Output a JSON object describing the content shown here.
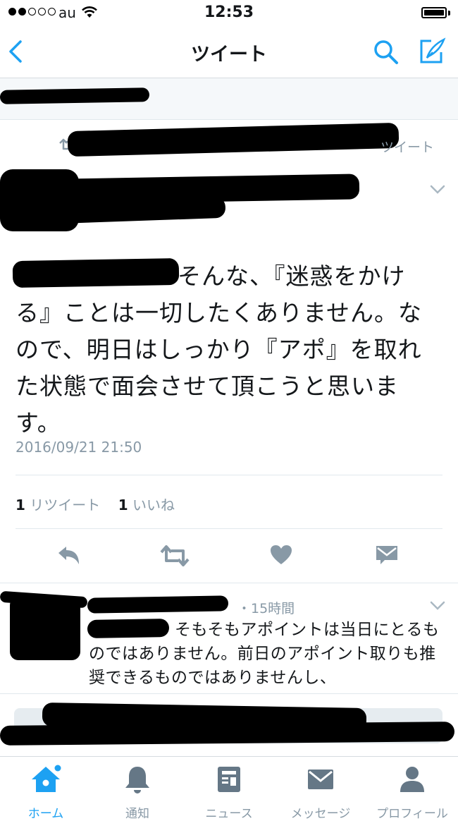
{
  "status_bar": {
    "carrier": "au",
    "time": "12:53"
  },
  "nav": {
    "title": "ツイート"
  },
  "tweet": {
    "retweeted_suffix": "ツイート",
    "body_visible": "そんな、『迷惑をかける』ことは一切したくありません。なので、明日はしっかり『アポ』を取れた状態で面会させて頂こうと思います。",
    "timestamp": "2016/09/21 21:50",
    "retweet_count": "1",
    "retweet_label": "リツイート",
    "like_count": "1",
    "like_label": "いいね"
  },
  "reply": {
    "meta": "・15時間",
    "text": "そもそもアポイントは当日にとるものではありません。前日のアポイント取りも推奨できるものではありませんし、"
  },
  "tabbar": {
    "items": [
      {
        "label": "ホーム",
        "icon": "home-icon",
        "active": true
      },
      {
        "label": "通知",
        "icon": "bell-icon"
      },
      {
        "label": "ニュース",
        "icon": "news-icon"
      },
      {
        "label": "メッセージ",
        "icon": "envelope-icon"
      },
      {
        "label": "プロフィール",
        "icon": "person-icon"
      }
    ]
  },
  "colors": {
    "accent": "#1da1f2",
    "muted": "#8899a6",
    "icon_gray": "#657786"
  }
}
